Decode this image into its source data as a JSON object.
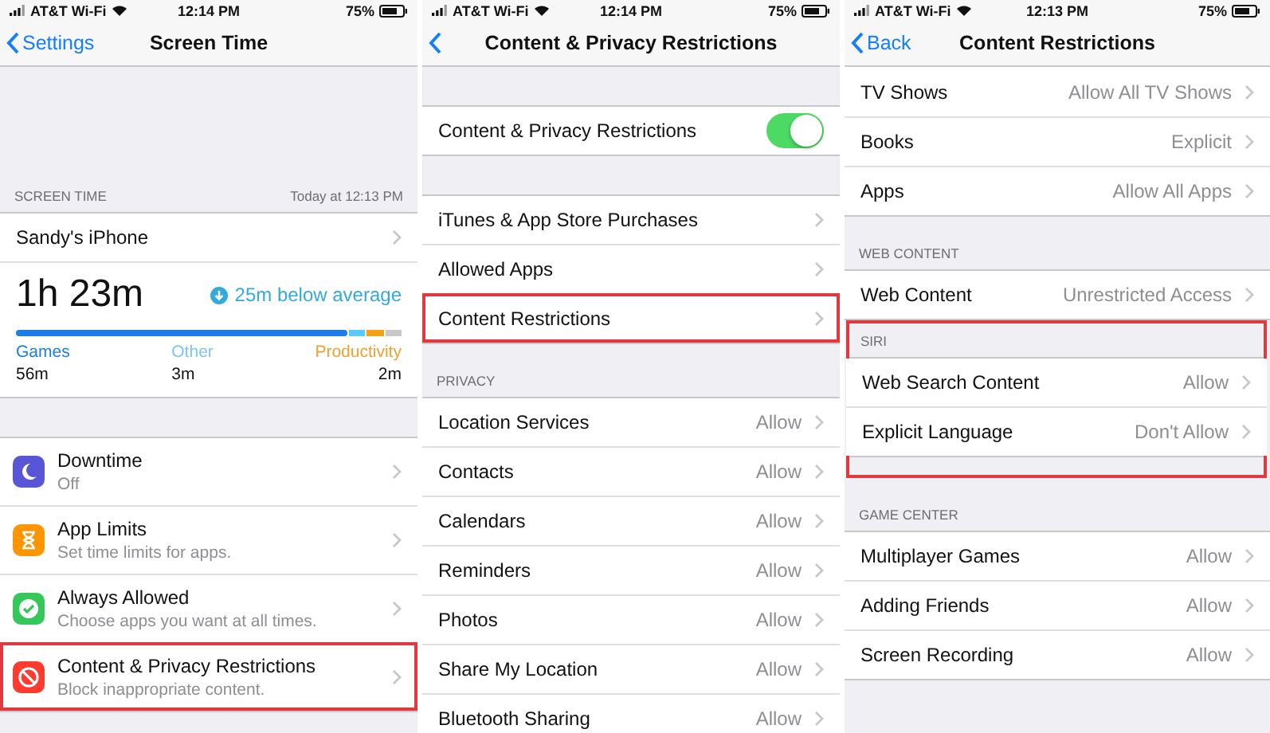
{
  "screens": [
    {
      "status": {
        "carrier": "AT&T Wi-Fi",
        "time": "12:14 PM",
        "battery": "75%"
      },
      "nav": {
        "back": "Settings",
        "title": "Screen Time"
      },
      "sections": [
        {
          "header": "SCREEN TIME",
          "header_right": "Today at 12:13 PM",
          "highlighted": false,
          "continued": false,
          "rows": [
            {
              "kind": "link",
              "label": "Sandy's iPhone",
              "highlighted": false
            },
            {
              "kind": "usage",
              "total": "1h 23m",
              "comparison": "25m below average",
              "usage_bar": {
                "level": 0.86,
                "segments": [
                  {
                    "color": "#1a7ee6"
                  },
                  {
                    "color": "#5ac8fa"
                  },
                  {
                    "color": "#f5a01a"
                  }
                ]
              },
              "legend": [
                {
                  "name": "Games",
                  "value": "56m",
                  "color": "#1a7ee6"
                },
                {
                  "name": "Other",
                  "value": "3m",
                  "color": "#7fc6ef"
                },
                {
                  "name": "Productivity",
                  "value": "2m",
                  "color": "#f0a030"
                }
              ]
            }
          ]
        },
        {
          "highlighted": false,
          "continued": false,
          "rows": [
            {
              "kind": "icon",
              "color": "#5856d6",
              "label": "Downtime",
              "subtitle": "Off",
              "highlighted": false
            },
            {
              "kind": "icon",
              "color": "#ff9500",
              "label": "App Limits",
              "subtitle": "Set time limits for apps.",
              "highlighted": false
            },
            {
              "kind": "icon",
              "color": "#34c759",
              "label": "Always Allowed",
              "subtitle": "Choose apps you want at all times.",
              "highlighted": false
            },
            {
              "kind": "icon",
              "color": "#ff3b30",
              "label": "Content & Privacy Restrictions",
              "subtitle": "Block inappropriate content.",
              "highlighted": true
            }
          ]
        }
      ]
    },
    {
      "status": {
        "carrier": "AT&T Wi-Fi",
        "time": "12:14 PM",
        "battery": "75%"
      },
      "nav": {
        "title": "Content & Privacy Restrictions"
      },
      "sections": [
        {
          "highlighted": false,
          "continued": false,
          "rows": [
            {
              "kind": "toggle",
              "label": "Content & Privacy Restrictions",
              "on": true
            }
          ]
        },
        {
          "highlighted": false,
          "continued": false,
          "rows": [
            {
              "kind": "link",
              "label": "iTunes & App Store Purchases",
              "highlighted": false
            },
            {
              "kind": "link",
              "label": "Allowed Apps",
              "highlighted": false
            },
            {
              "kind": "link",
              "label": "Content Restrictions",
              "highlighted": true
            }
          ]
        },
        {
          "header": "PRIVACY",
          "highlighted": false,
          "continued": false,
          "rows": [
            {
              "kind": "link",
              "label": "Location Services",
              "value": "Allow",
              "highlighted": false
            },
            {
              "kind": "link",
              "label": "Contacts",
              "value": "Allow",
              "highlighted": false
            },
            {
              "kind": "link",
              "label": "Calendars",
              "value": "Allow",
              "highlighted": false
            },
            {
              "kind": "link",
              "label": "Reminders",
              "value": "Allow",
              "highlighted": false
            },
            {
              "kind": "link",
              "label": "Photos",
              "value": "Allow",
              "highlighted": false
            },
            {
              "kind": "link",
              "label": "Share My Location",
              "value": "Allow",
              "highlighted": false
            },
            {
              "kind": "link",
              "label": "Bluetooth Sharing",
              "value": "Allow",
              "highlighted": false
            }
          ]
        }
      ]
    },
    {
      "status": {
        "carrier": "AT&T Wi-Fi",
        "time": "12:13 PM",
        "battery": "75%"
      },
      "nav": {
        "back": "Back",
        "title": "Content Restrictions"
      },
      "sections": [
        {
          "highlighted": false,
          "continued": true,
          "rows": [
            {
              "kind": "link",
              "label": "TV Shows",
              "value": "Allow All TV Shows",
              "highlighted": false
            },
            {
              "kind": "link",
              "label": "Books",
              "value": "Explicit",
              "highlighted": false
            },
            {
              "kind": "link",
              "label": "Apps",
              "value": "Allow All Apps",
              "highlighted": false
            }
          ]
        },
        {
          "header": "WEB CONTENT",
          "highlighted": false,
          "continued": false,
          "rows": [
            {
              "kind": "link",
              "label": "Web Content",
              "value": "Unrestricted Access",
              "highlighted": false
            }
          ]
        },
        {
          "header": "SIRI",
          "highlighted": true,
          "continued": false,
          "rows": [
            {
              "kind": "link",
              "label": "Web Search Content",
              "value": "Allow",
              "highlighted": false
            },
            {
              "kind": "link",
              "label": "Explicit Language",
              "value": "Don't Allow",
              "highlighted": false
            }
          ]
        },
        {
          "header": "GAME CENTER",
          "highlighted": false,
          "continued": false,
          "rows": [
            {
              "kind": "link",
              "label": "Multiplayer Games",
              "value": "Allow",
              "highlighted": false
            },
            {
              "kind": "link",
              "label": "Adding Friends",
              "value": "Allow",
              "highlighted": false
            },
            {
              "kind": "link",
              "label": "Screen Recording",
              "value": "Allow",
              "highlighted": false
            }
          ]
        }
      ]
    }
  ]
}
